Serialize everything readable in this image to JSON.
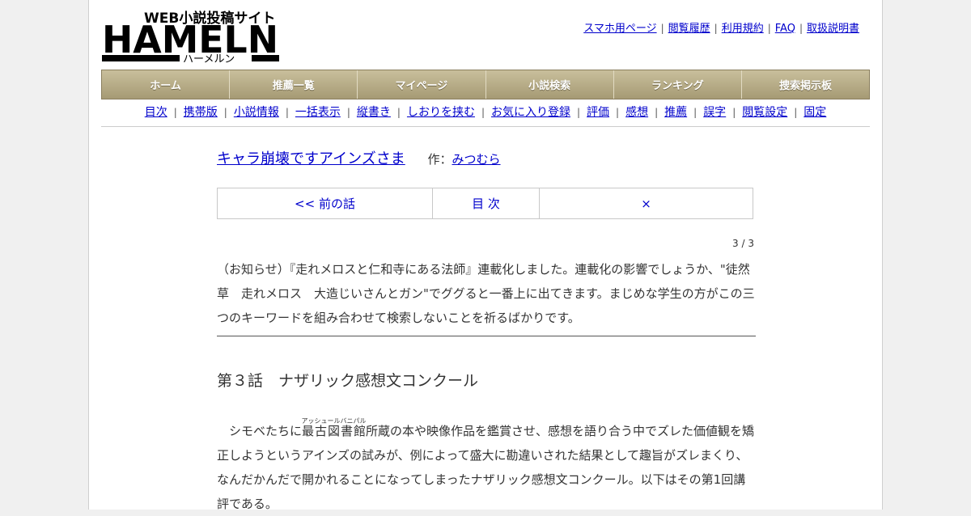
{
  "site": {
    "logo_tagline": "WEB小説投稿サイト",
    "logo_name": "HAMELN",
    "logo_kana": "ハーメルン"
  },
  "top_links": [
    "スマホ用ページ",
    "閲覧履歴",
    "利用規約",
    "FAQ",
    "取扱説明書"
  ],
  "global_nav": [
    "ホーム",
    "推薦一覧",
    "マイページ",
    "小説検索",
    "ランキング",
    "捜索掲示板"
  ],
  "sub_nav": [
    "目次",
    "携帯版",
    "小説情報",
    "一括表示",
    "縦書き",
    "しおりを挟む",
    "お気に入り登録",
    "評価",
    "感想",
    "推薦",
    "誤字",
    "閲覧設定",
    "固定"
  ],
  "novel": {
    "title": "キャラ崩壊ですアインズさま",
    "author_label": "作：",
    "author": "みつむら"
  },
  "episode_nav": {
    "prev": "<< 前の話",
    "toc": "目 次",
    "next": "×"
  },
  "page_indicator": "3 / 3",
  "notice": "（お知らせ）『走れメロスと仁和寺にある法師』連載化しました。連載化の影響でしょうか、\"徒然草　走れメロス　大造じいさんとガン\"でググると一番上に出てきます。まじめな学生の方がこの三つのキーワードを組み合わせて検索しないことを祈るばかりです。",
  "chapter_title": "第３話　ナザリック感想文コンクール",
  "body": {
    "before_ruby": "　シモベたちに",
    "ruby_base": "最古図書館",
    "ruby_text": "アッシュールバニパル",
    "after_ruby": "所蔵の本や映像作品を鑑賞させ、感想を語り合う中でズレた価値観を矯正しようというアインズの試みが、例によって盛大に勘違いされた結果として趣旨がズレまくり、なんだかんだで開かれることになってしまったナザリック感想文コンクール。以下はその第1回講評である。"
  },
  "colors": {
    "nav_bg": "#b5aa85",
    "link": "#0000cc",
    "logo": "#000000"
  }
}
